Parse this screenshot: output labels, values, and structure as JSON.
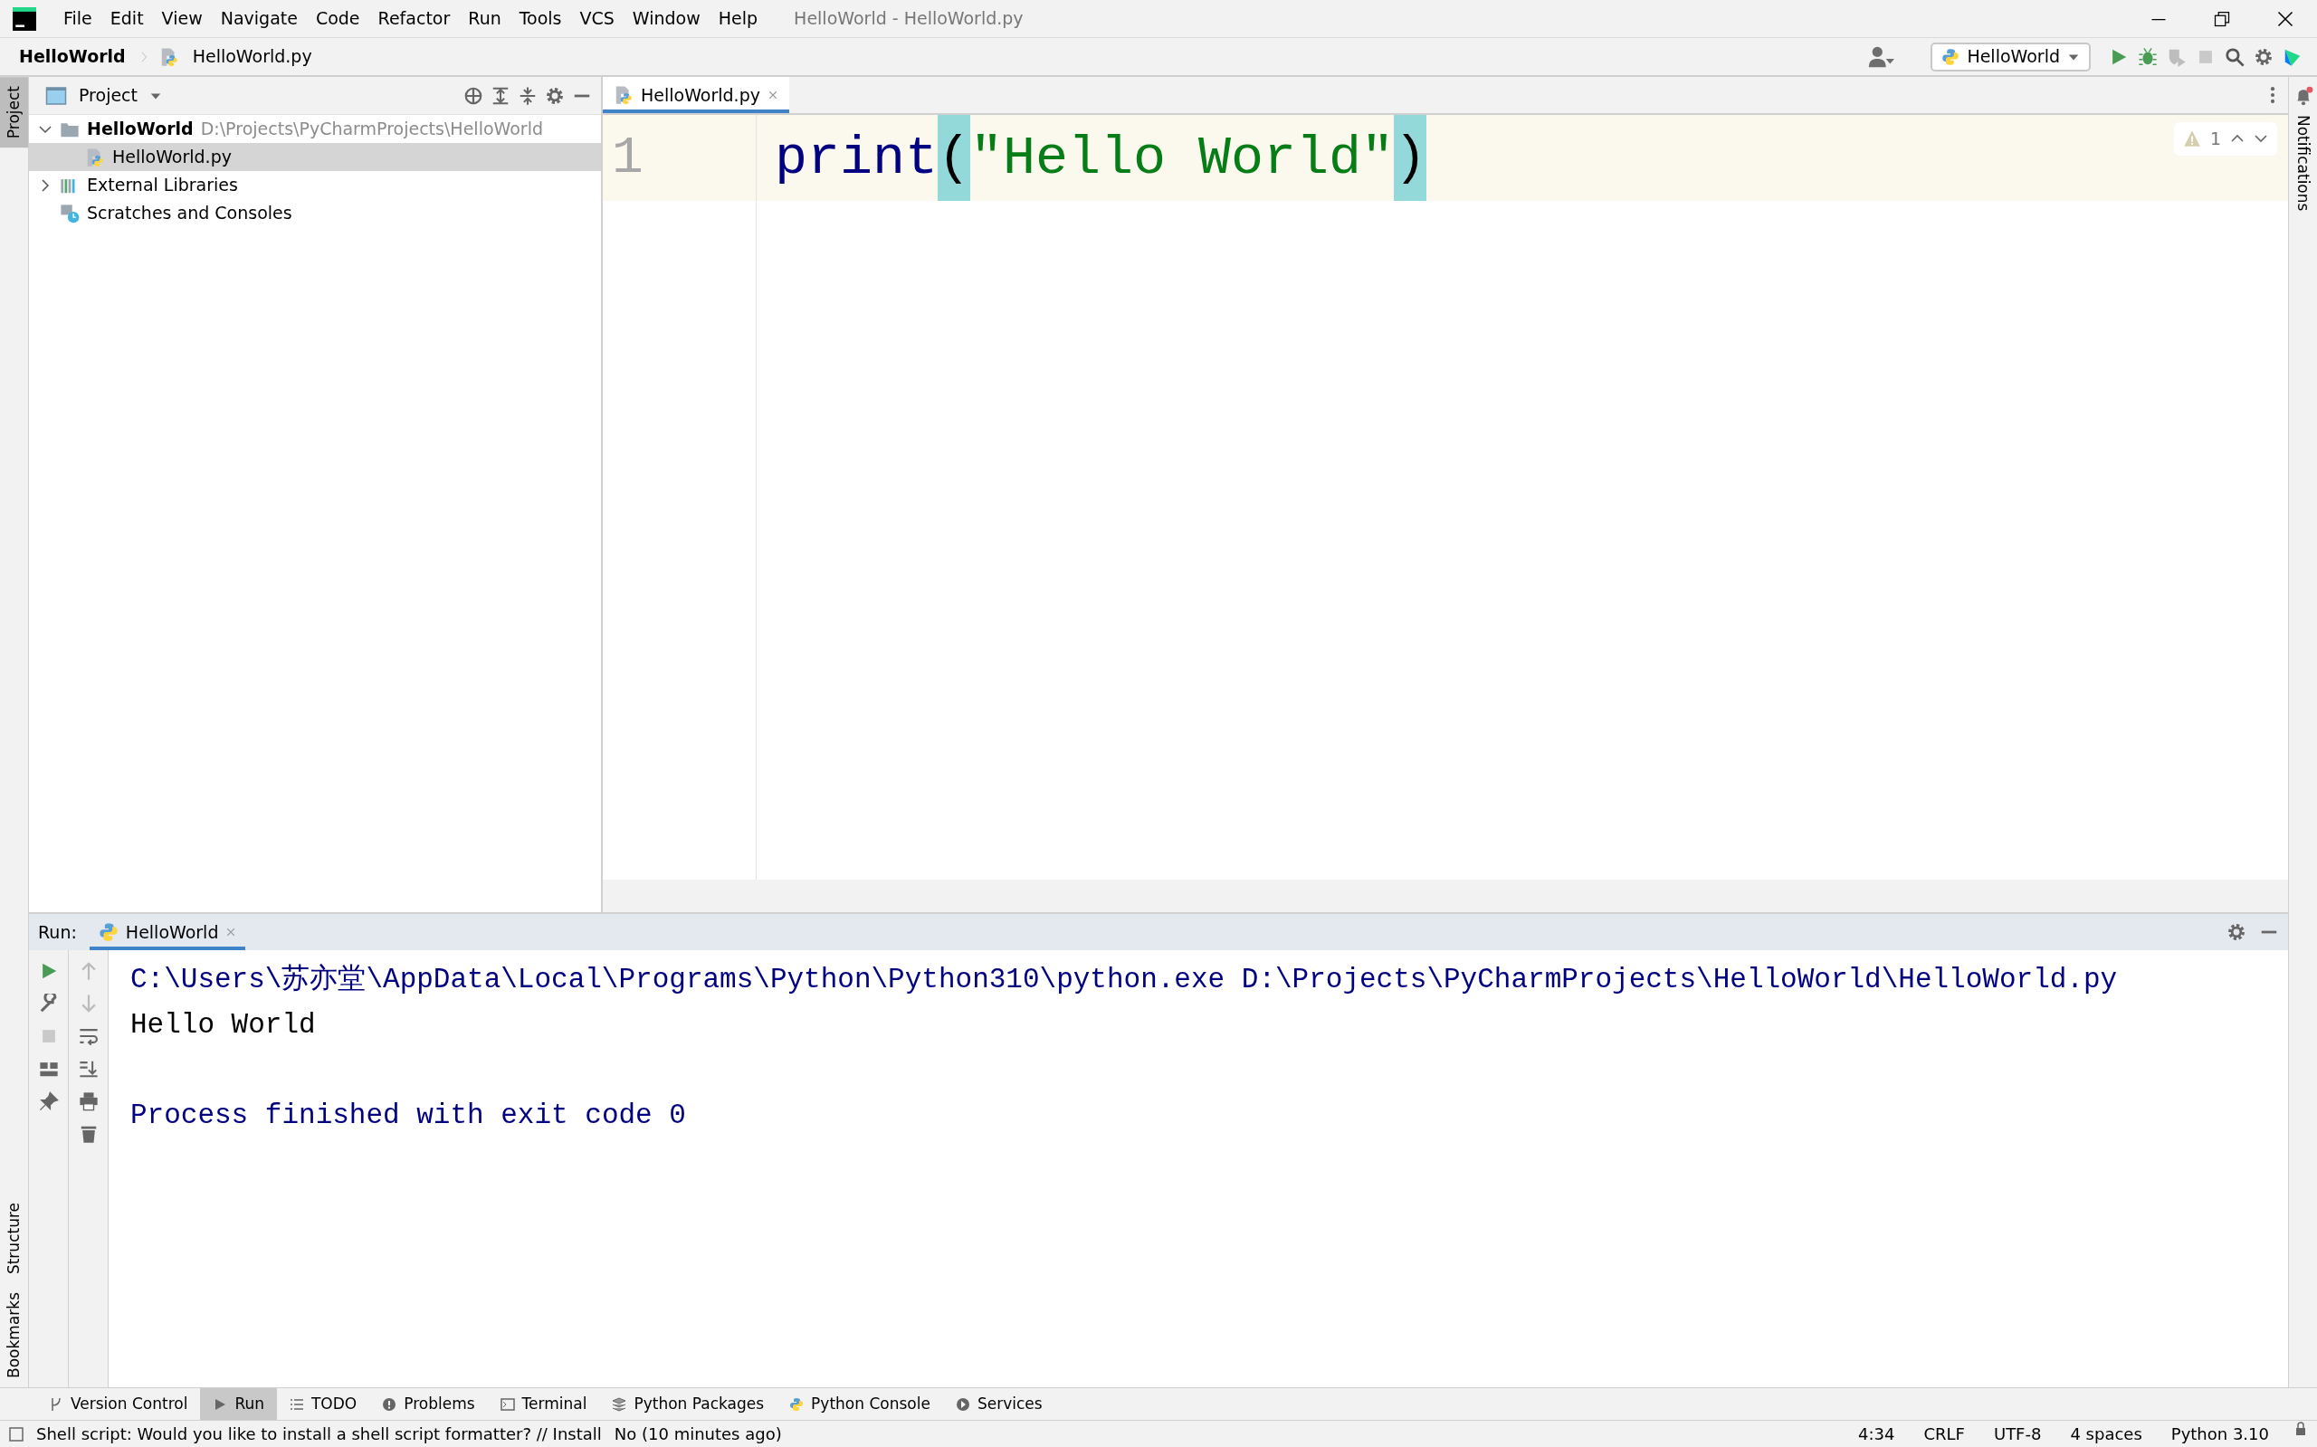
{
  "menu": [
    "File",
    "Edit",
    "View",
    "Navigate",
    "Code",
    "Refactor",
    "Run",
    "Tools",
    "VCS",
    "Window",
    "Help"
  ],
  "window": {
    "title": "HelloWorld - HelloWorld.py"
  },
  "breadcrumbs": [
    "HelloWorld",
    "HelloWorld.py"
  ],
  "run_config": "HelloWorld",
  "left_stripe": [
    {
      "label": "Project",
      "selected": true
    },
    {
      "label": "Structure",
      "selected": false
    },
    {
      "label": "Bookmarks",
      "selected": false
    }
  ],
  "right_stripe": [
    {
      "label": "Notifications",
      "selected": false
    }
  ],
  "project_panel": {
    "title": "Project",
    "tree": [
      {
        "label": "HelloWorld",
        "path": "D:\\Projects\\PyCharmProjects\\HelloWorld",
        "kind": "folder",
        "expanded": true,
        "selected": false,
        "children": [
          {
            "label": "HelloWorld.py",
            "kind": "python",
            "selected": true
          }
        ]
      },
      {
        "label": "External Libraries",
        "kind": "libraries",
        "expanded": false,
        "selected": false
      },
      {
        "label": "Scratches and Consoles",
        "kind": "scratches",
        "selected": false
      }
    ]
  },
  "editor": {
    "tabs": [
      {
        "label": "HelloWorld.py",
        "selected": true
      }
    ],
    "warnings": "1",
    "lines": [
      {
        "number": "1",
        "tokens": [
          {
            "text": "print",
            "kind": "function",
            "highlighted": false
          },
          {
            "text": "(",
            "kind": "paren",
            "highlighted": true
          },
          {
            "text": "\"Hello World\"",
            "kind": "string",
            "highlighted": false
          },
          {
            "text": ")",
            "kind": "paren",
            "highlighted": true
          }
        ]
      }
    ]
  },
  "run_panel": {
    "title": "Run:",
    "tabs": [
      {
        "label": "HelloWorld",
        "selected": true
      }
    ],
    "console": [
      {
        "text": "C:\\Users\\苏亦堂\\AppData\\Local\\Programs\\Python\\Python310\\python.exe D:\\Projects\\PyCharmProjects\\HelloWorld\\HelloWorld.py",
        "kind": "command"
      },
      {
        "text": "Hello World",
        "kind": "output"
      },
      {
        "text": "Process finished with exit code 0",
        "kind": "exit"
      }
    ]
  },
  "tool_windows": [
    {
      "label": "Version Control",
      "selected": false
    },
    {
      "label": "Run",
      "selected": true
    },
    {
      "label": "TODO",
      "selected": false
    },
    {
      "label": "Problems",
      "selected": false
    },
    {
      "label": "Terminal",
      "selected": false
    },
    {
      "label": "Python Packages",
      "selected": false
    },
    {
      "label": "Python Console",
      "selected": false
    },
    {
      "label": "Services",
      "selected": false
    }
  ],
  "status_bar": {
    "message": "Shell script: Would you like to install a shell script formatter? // Install",
    "time": "No (10 minutes ago)",
    "items": [
      "4:34",
      "CRLF",
      "UTF-8",
      "4 spaces",
      "Python 3.10"
    ]
  }
}
